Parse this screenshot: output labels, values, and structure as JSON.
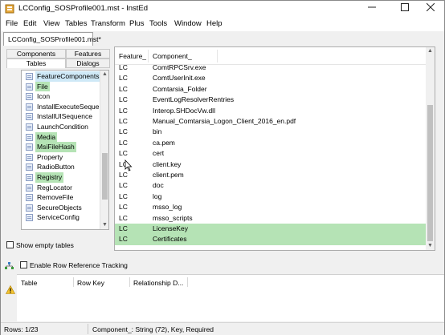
{
  "window": {
    "title": "LCConfig_SOSProfile001.mst - InstEd",
    "controls": [
      "minimize",
      "maximize",
      "close"
    ]
  },
  "menubar": [
    "File",
    "Edit",
    "View",
    "Tables",
    "Transform",
    "Plus",
    "Tools",
    "Window",
    "Help"
  ],
  "document_tab": "LCConfig_SOSProfile001.mst*",
  "left_panel": {
    "tabs_row1": [
      "Components",
      "Features"
    ],
    "tabs_row2": [
      "Tables",
      "Dialogs"
    ],
    "active_tab": "Tables",
    "tables": [
      {
        "name": "FeatureComponents",
        "highlight": "blue"
      },
      {
        "name": "File",
        "highlight": "green"
      },
      {
        "name": "Icon",
        "highlight": ""
      },
      {
        "name": "InstallExecuteSequen",
        "highlight": ""
      },
      {
        "name": "InstallUISequence",
        "highlight": ""
      },
      {
        "name": "LaunchCondition",
        "highlight": ""
      },
      {
        "name": "Media",
        "highlight": "green"
      },
      {
        "name": "MsiFileHash",
        "highlight": "green"
      },
      {
        "name": "Property",
        "highlight": ""
      },
      {
        "name": "RadioButton",
        "highlight": ""
      },
      {
        "name": "Registry",
        "highlight": "green"
      },
      {
        "name": "RegLocator",
        "highlight": ""
      },
      {
        "name": "RemoveFile",
        "highlight": ""
      },
      {
        "name": "SecureObjects",
        "highlight": ""
      },
      {
        "name": "ServiceConfig",
        "highlight": ""
      }
    ],
    "show_empty_tables_label": "Show empty tables",
    "show_empty_tables_checked": false
  },
  "grid": {
    "columns": [
      "Feature_",
      "Component_"
    ],
    "rows": [
      {
        "feature": "LC",
        "component": "ComtRPCSrv.exe",
        "highlight": false
      },
      {
        "feature": "LC",
        "component": "ComtUserInit.exe",
        "highlight": false
      },
      {
        "feature": "LC",
        "component": "Comtarsia_Folder",
        "highlight": false
      },
      {
        "feature": "LC",
        "component": "EventLogResolverRentries",
        "highlight": false
      },
      {
        "feature": "LC",
        "component": "Interop.SHDocVw.dll",
        "highlight": false
      },
      {
        "feature": "LC",
        "component": "Manual_Comtarsia_Logon_Client_2016_en.pdf",
        "highlight": false
      },
      {
        "feature": "LC",
        "component": "bin",
        "highlight": false
      },
      {
        "feature": "LC",
        "component": "ca.pem",
        "highlight": false
      },
      {
        "feature": "LC",
        "component": "cert",
        "highlight": false
      },
      {
        "feature": "LC",
        "component": "client.key",
        "highlight": false
      },
      {
        "feature": "LC",
        "component": "client.pem",
        "highlight": false
      },
      {
        "feature": "LC",
        "component": "doc",
        "highlight": false
      },
      {
        "feature": "LC",
        "component": "log",
        "highlight": false
      },
      {
        "feature": "LC",
        "component": "msso_log",
        "highlight": false
      },
      {
        "feature": "LC",
        "component": "msso_scripts",
        "highlight": false
      },
      {
        "feature": "LC",
        "component": "LicenseKey",
        "highlight": true
      },
      {
        "feature": "LC",
        "component": "Certificates",
        "highlight": true
      }
    ]
  },
  "lower_panel": {
    "enable_tracking_label": "Enable Row Reference Tracking",
    "enable_tracking_checked": false,
    "columns": [
      "Table",
      "Row Key",
      "Relationship D..."
    ]
  },
  "statusbar": {
    "rows": "Rows: 1/23",
    "column_info": "Component_: String (72), Key, Required"
  },
  "colors": {
    "highlight_green": "#b5e3b5",
    "highlight_blue": "#cfe9f7"
  }
}
